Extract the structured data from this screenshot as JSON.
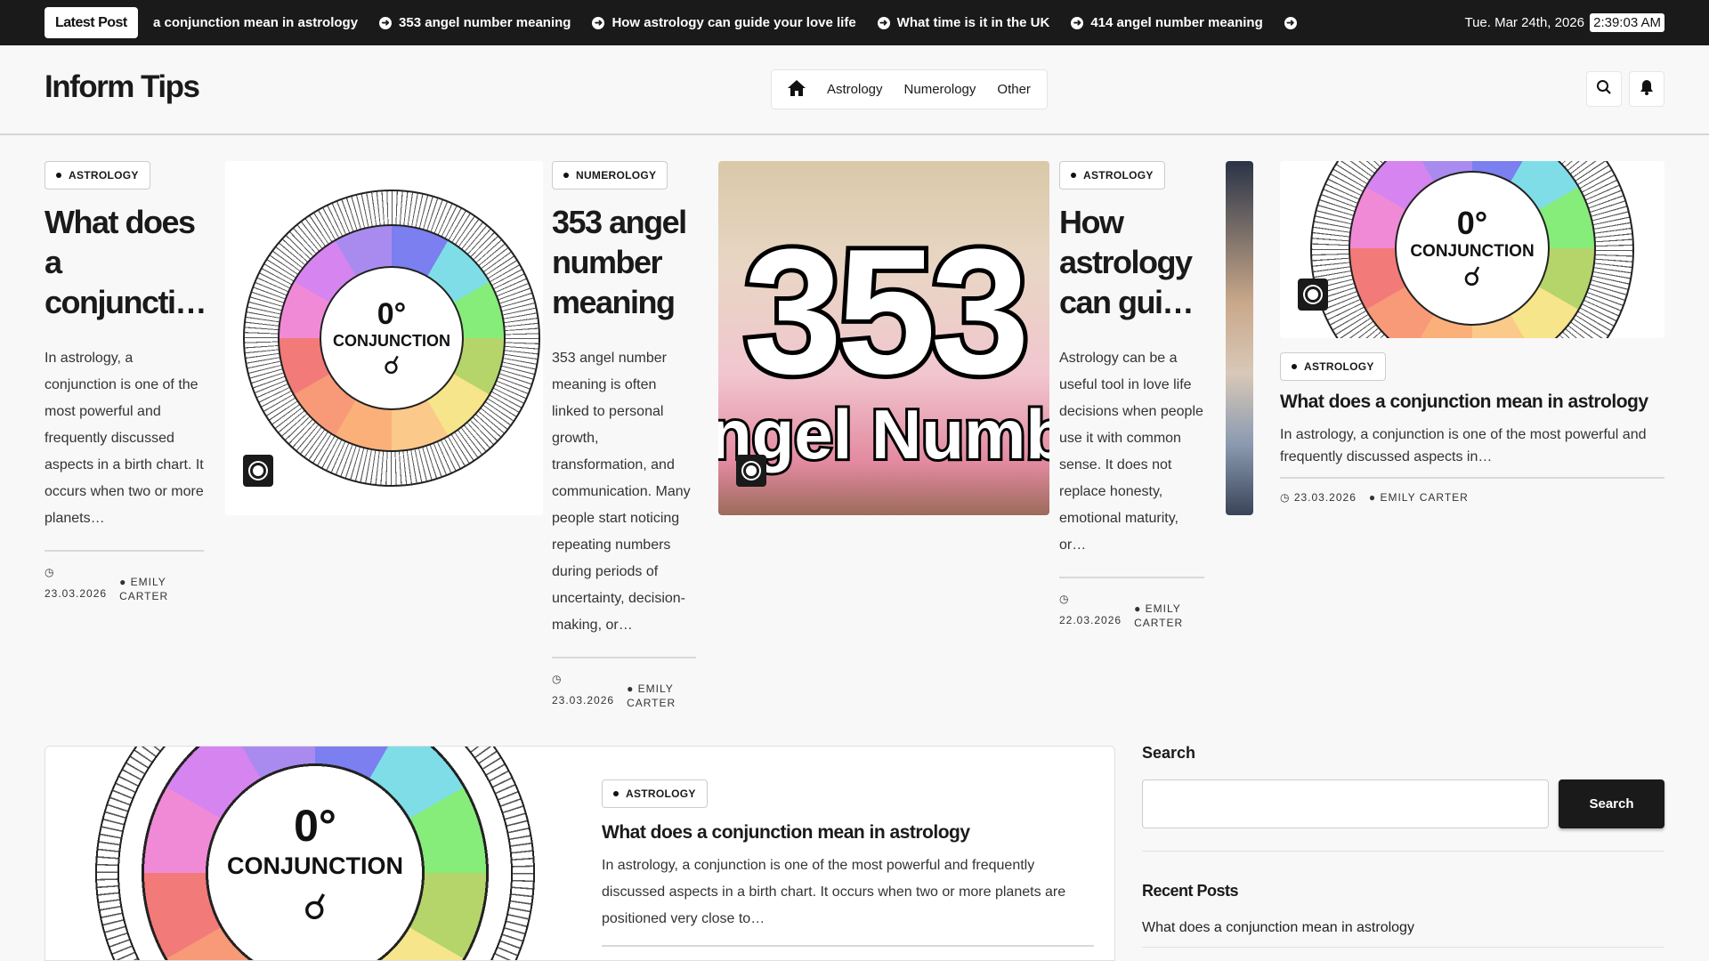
{
  "topbar": {
    "latest_label": "Latest Post",
    "ticker": [
      "a conjunction mean in astrology",
      "353 angel number meaning",
      "How astrology can guide your love life",
      "What time is it in the UK",
      "414 angel number meaning"
    ],
    "date": "Tue. Mar 24th, 2026",
    "time": "2:39:03 AM"
  },
  "header": {
    "logo": "Inform Tips",
    "nav": [
      "Astrology",
      "Numerology",
      "Other"
    ]
  },
  "wheel": {
    "degree": "0°",
    "label": "CONJUNCTION",
    "glyph": "☌"
  },
  "image353": {
    "number": "353",
    "caption": "ngel Numb"
  },
  "cards": [
    {
      "tag": "ASTROLOGY",
      "title": "What does a conjuncti…",
      "excerpt": "In astrology, a conjunction is one of the most powerful and frequently discussed aspects in a birth chart. It occurs when two or more planets…",
      "date": "23.03.2026",
      "author": "EMILY CARTER"
    },
    {
      "tag": "NUMEROLOGY",
      "title": "353 angel number meaning",
      "excerpt": "353 angel number meaning is often linked to personal growth, transformation, and communication. Many people start noticing repeating numbers during periods of uncertainty, decision-making, or…",
      "date": "23.03.2026",
      "author": "EMILY CARTER"
    },
    {
      "tag": "ASTROLOGY",
      "title": "How astrology can gui…",
      "excerpt": "Astrology can be a useful tool in love life decisions when people use it with common sense. It does not replace honesty, emotional maturity, or…",
      "date": "22.03.2026",
      "author": "EMILY CARTER"
    },
    {
      "tag": "ASTROLOGY",
      "title": "What does a conjunction mean in astrology",
      "excerpt": "In astrology, a conjunction is one of the most powerful and frequently discussed aspects in…",
      "date": "23.03.2026",
      "author": "EMILY CARTER"
    }
  ],
  "featured": {
    "tag": "ASTROLOGY",
    "title": "What does a conjunction mean in astrology",
    "excerpt": "In astrology, a conjunction is one of the most powerful and frequently discussed aspects in a birth chart. It occurs when two or more planets are positioned very close to…"
  },
  "sidebar": {
    "search_heading": "Search",
    "search_value": "",
    "search_button": "Search",
    "recent_heading": "Recent Posts",
    "recent": [
      "What does a conjunction mean in astrology"
    ]
  }
}
